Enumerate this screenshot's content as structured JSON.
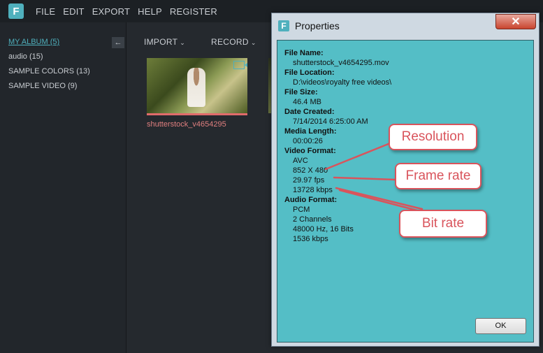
{
  "app": {
    "logo_letter": "F",
    "menu": [
      "FILE",
      "EDIT",
      "EXPORT",
      "HELP",
      "REGISTER"
    ]
  },
  "sidebar": {
    "items": [
      {
        "label": "MY ALBUM (5)",
        "active": true
      },
      {
        "label": "audio (15)"
      },
      {
        "label": "SAMPLE COLORS (13)"
      },
      {
        "label": "SAMPLE VIDEO (9)"
      }
    ],
    "collapse_icon": "arrow-left-icon"
  },
  "toolbar": {
    "import_label": "IMPORT",
    "record_label": "RECORD"
  },
  "media": {
    "items": [
      {
        "name": "shutterstock_v4654295",
        "icon": "video-camera-icon"
      }
    ]
  },
  "dialog": {
    "title": "Properties",
    "close_icon": "close-icon",
    "fields": {
      "file_name_label": "File Name:",
      "file_name": "shutterstock_v4654295.mov",
      "file_location_label": "File Location:",
      "file_location": "D:\\videos\\royalty free videos\\",
      "file_size_label": "File Size:",
      "file_size": "46.4 MB",
      "date_created_label": "Date Created:",
      "date_created": "7/14/2014 6:25:00 AM",
      "media_length_label": "Media Length:",
      "media_length": "00:00:26",
      "video_format_label": "Video Format:",
      "video_codec": "AVC",
      "video_resolution": "852 X 480",
      "video_fps": "29.97  fps",
      "video_bitrate": "13728  kbps",
      "audio_format_label": "Audio Format:",
      "audio_codec": "PCM",
      "audio_channels": "2 Channels",
      "audio_sample": "48000  Hz, 16 Bits",
      "audio_bitrate": "1536  kbps"
    },
    "ok_label": "OK"
  },
  "callouts": {
    "resolution": "Resolution",
    "frame_rate": "Frame rate",
    "bit_rate": "Bit rate"
  },
  "colors": {
    "accent": "#4fb0bd",
    "dialog_body": "#54bec6",
    "callout_border": "#d9545c"
  }
}
